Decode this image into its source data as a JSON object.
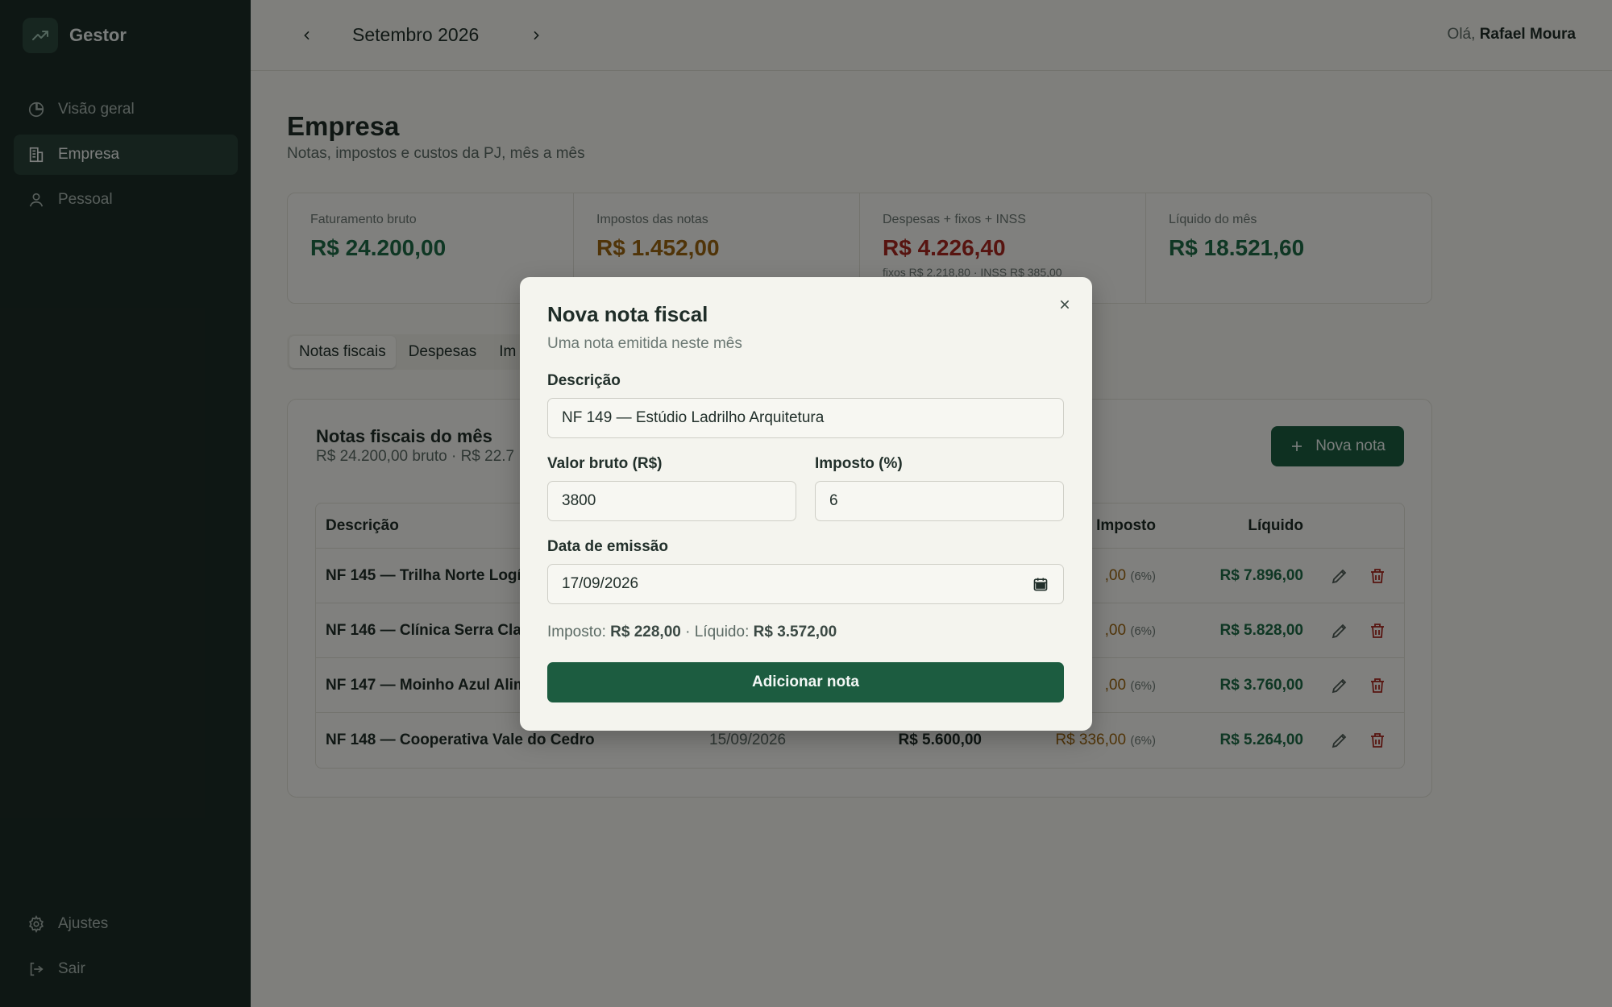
{
  "sidebar": {
    "brand": "Gestor",
    "items": [
      {
        "label": "Visão geral",
        "icon": "pie-chart-icon"
      },
      {
        "label": "Empresa",
        "icon": "building-icon"
      },
      {
        "label": "Pessoal",
        "icon": "user-icon"
      }
    ],
    "bottom": [
      {
        "label": "Ajustes",
        "icon": "gear-icon"
      },
      {
        "label": "Sair",
        "icon": "logout-icon"
      }
    ]
  },
  "topbar": {
    "month": "Setembro 2026",
    "greeting_prefix": "Olá,",
    "user": "Rafael Moura"
  },
  "page": {
    "title": "Empresa",
    "subtitle": "Notas, impostos e custos da PJ, mês a mês"
  },
  "stats": [
    {
      "label": "Faturamento bruto",
      "value": "R$ 24.200,00",
      "sub": ""
    },
    {
      "label": "Impostos das notas",
      "value": "R$ 1.452,00",
      "sub": ""
    },
    {
      "label": "Despesas + fixos + INSS",
      "value": "R$ 4.226,40",
      "sub": "fixos R$ 2.218,80 · INSS R$ 385,00"
    },
    {
      "label": "Líquido do mês",
      "value": "R$ 18.521,60",
      "sub": ""
    }
  ],
  "tabs": [
    "Notas fiscais",
    "Despesas",
    "Im"
  ],
  "card": {
    "title": "Notas fiscais do mês",
    "subtitle": "R$ 24.200,00 bruto · R$ 22.7",
    "new_button": "Nova nota"
  },
  "table": {
    "headers": {
      "desc": "Descrição",
      "imposto": "Imposto",
      "liquido": "Líquido"
    },
    "rows": [
      {
        "desc": "NF 145 — Trilha Norte Logís",
        "date": "",
        "bruto": "",
        "imposto": ",00",
        "pct": "(6%)",
        "liquido": "R$ 7.896,00"
      },
      {
        "desc": "NF 146 — Clínica Serra Clar",
        "date": "",
        "bruto": "",
        "imposto": ",00",
        "pct": "(6%)",
        "liquido": "R$ 5.828,00"
      },
      {
        "desc": "NF 147 — Moinho Azul Alim",
        "date": "",
        "bruto": "",
        "imposto": ",00",
        "pct": "(6%)",
        "liquido": "R$ 3.760,00"
      },
      {
        "desc": "NF 148 — Cooperativa Vale do Cedro",
        "date": "15/09/2026",
        "bruto": "R$ 5.600,00",
        "imposto": "R$ 336,00",
        "pct": "(6%)",
        "liquido": "R$ 5.264,00"
      }
    ]
  },
  "modal": {
    "title": "Nova nota fiscal",
    "subtitle": "Uma nota emitida neste mês",
    "desc_label": "Descrição",
    "desc_value": "NF 149 — Estúdio Ladrilho Arquitetura",
    "valor_label": "Valor bruto (R$)",
    "valor_value": "3800",
    "imposto_label": "Imposto (%)",
    "imposto_value": "6",
    "data_label": "Data de emissão",
    "data_value": "17/09/2026",
    "summary_imposto_label": "Imposto:",
    "summary_imposto": "R$ 228,00",
    "summary_sep": "·",
    "summary_liquido_label": "Líquido:",
    "summary_liquido": "R$ 3.572,00",
    "submit": "Adicionar nota"
  },
  "colors": {
    "sidebar": "#1c2d27",
    "accent": "#1c5c40",
    "positive": "#1d6a45",
    "tax": "#9a6410",
    "negative": "#a8281f"
  }
}
